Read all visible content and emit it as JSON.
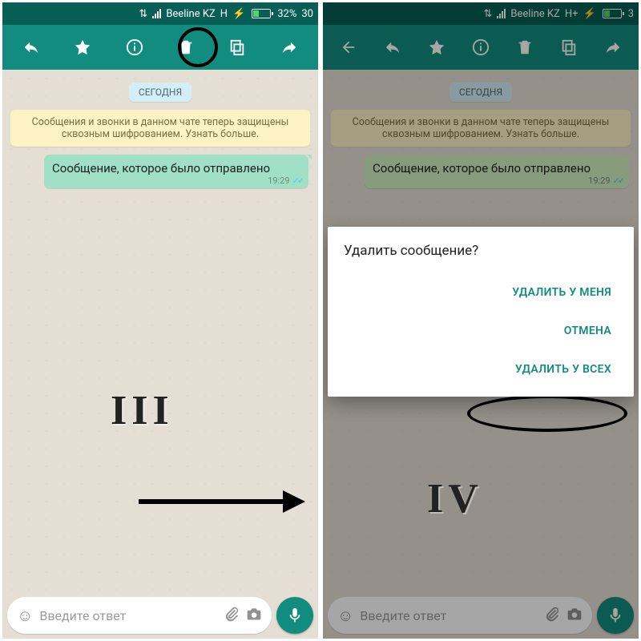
{
  "status": {
    "carrier": "Beeline KZ",
    "net_left": "H",
    "net_right": "H+",
    "charging": "⚡",
    "battery": "32%",
    "trailing_left": "30",
    "trailing_right": "3"
  },
  "chat": {
    "date_chip": "СЕГОДНЯ",
    "encryption_banner": "Сообщения и звонки в данном чате теперь защищены сквозным шифрованием. Узнать больше.",
    "message_text": "Сообщение, которое было отправлено",
    "message_time": "19:29",
    "message_ticks": "✓✓",
    "input_placeholder": "Введите ответ"
  },
  "dialog": {
    "title": "Удалить сообщение?",
    "delete_for_me": "УДАЛИТЬ У МЕНЯ",
    "cancel": "ОТМЕНА",
    "delete_for_all": "УДАЛИТЬ У ВСЕХ"
  },
  "labels": {
    "step_left": "III",
    "step_right": "IV"
  },
  "icons": {
    "reply": "reply",
    "star": "star",
    "info": "info",
    "trash": "trash",
    "copy": "copy",
    "forward": "forward",
    "back": "back",
    "smile": "smile",
    "attach": "attach",
    "camera": "camera",
    "mic": "mic"
  }
}
